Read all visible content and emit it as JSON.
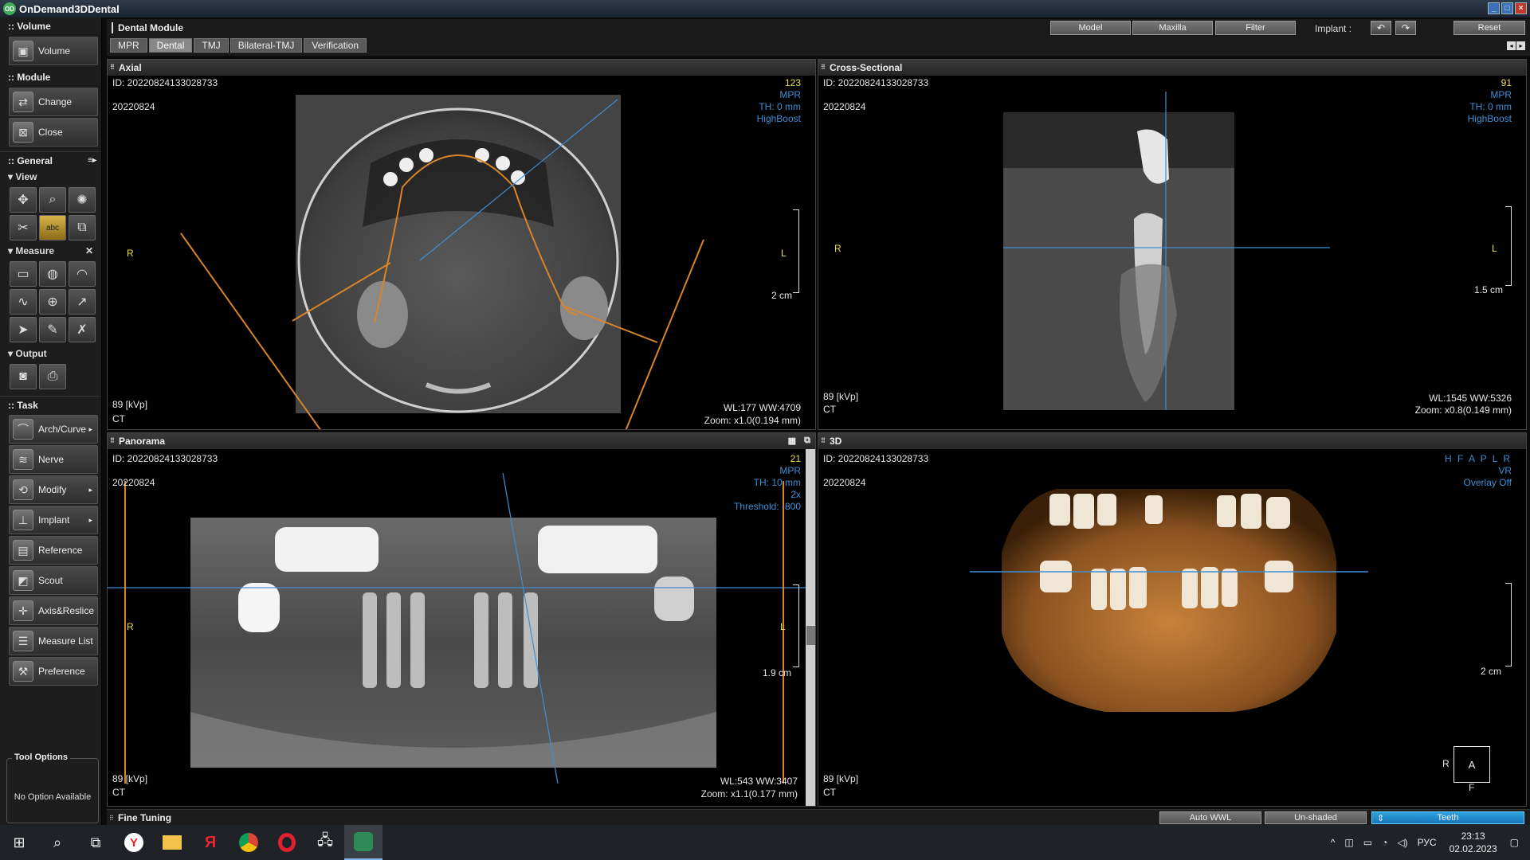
{
  "app": {
    "title": "OnDemand3DDental",
    "logo": "OD"
  },
  "sidebar": {
    "volume_header": ":: Volume",
    "volume_btn": "Volume",
    "module_header": ":: Module",
    "change_btn": "Change",
    "close_btn": "Close",
    "general_header": ":: General",
    "view_header": "View",
    "measure_header": "Measure",
    "output_header": "Output",
    "task_header": ":: Task",
    "tasks": [
      {
        "label": "Arch/Curve",
        "arrow": "▸"
      },
      {
        "label": "Nerve"
      },
      {
        "label": "Modify",
        "arrow": "▸"
      },
      {
        "label": "Implant",
        "arrow": "▸"
      },
      {
        "label": "Reference"
      },
      {
        "label": "Scout"
      },
      {
        "label": "Axis&Reslice"
      },
      {
        "label": "Measure List"
      },
      {
        "label": "Preference"
      }
    ],
    "tool_options": {
      "title": "Tool Options",
      "value": "No Option Available"
    }
  },
  "header": {
    "module_title": "Dental Module",
    "tabs": [
      "MPR",
      "Dental",
      "TMJ",
      "Bilateral-TMJ",
      "Verification"
    ],
    "active_tab": "Dental",
    "btn_model": "Model",
    "btn_maxilla": "Maxilla",
    "btn_filter": "Filter",
    "implant_label": "Implant :",
    "btn_reset": "Reset"
  },
  "views": {
    "axial": {
      "title": "Axial",
      "id": "ID: 20220824133028733",
      "date": "20220824",
      "slice": "123",
      "mode": "MPR",
      "th": "TH: 0 mm",
      "filter": "HighBoost",
      "r": "R",
      "l": "L",
      "scale": "2 cm",
      "kvp": "89 [kVp]",
      "modality": "CT",
      "wl": "WL:177 WW:4709",
      "zoom": "Zoom: x1.0(0.194 mm)"
    },
    "cross": {
      "title": "Cross-Sectional",
      "id": "ID: 20220824133028733",
      "date": "20220824",
      "slice": "91",
      "mode": "MPR",
      "th": "TH: 0 mm",
      "filter": "HighBoost",
      "r": "R",
      "l": "L",
      "scale": "1.5 cm",
      "kvp": "89 [kVp]",
      "modality": "CT",
      "wl": "WL:1545 WW:5326",
      "zoom": "Zoom: x0.8(0.149 mm)"
    },
    "panorama": {
      "title": "Panorama",
      "id": "ID: 20220824133028733",
      "date": "20220824",
      "slice": "21",
      "mode": "MPR",
      "th": "TH: 10 mm",
      "mult": "2x",
      "threshold": "Threshold: -800",
      "r": "R",
      "l": "L",
      "scale": "1.9 cm",
      "kvp": "89 [kVp]",
      "modality": "CT",
      "wl": "WL:543 WW:3407",
      "zoom": "Zoom: x1.1(0.177 mm)"
    },
    "vr": {
      "title": "3D",
      "id": "ID: 20220824133028733",
      "date": "20220824",
      "orient": "H F A P L R",
      "mode": "VR",
      "overlay": "Overlay Off",
      "scale": "2 cm",
      "kvp": "89 [kVp]",
      "modality": "CT",
      "cube_face": "A",
      "cube_left": "R",
      "cube_bottom": "F"
    }
  },
  "fine": {
    "title": "Fine Tuning",
    "auto_wwl": "Auto WWL",
    "unshaded": "Un-shaded",
    "teeth": "Teeth",
    "teeth_icon": "⇕"
  },
  "taskbar": {
    "lang": "РУС",
    "time": "23:13",
    "date": "02.02.2023"
  }
}
